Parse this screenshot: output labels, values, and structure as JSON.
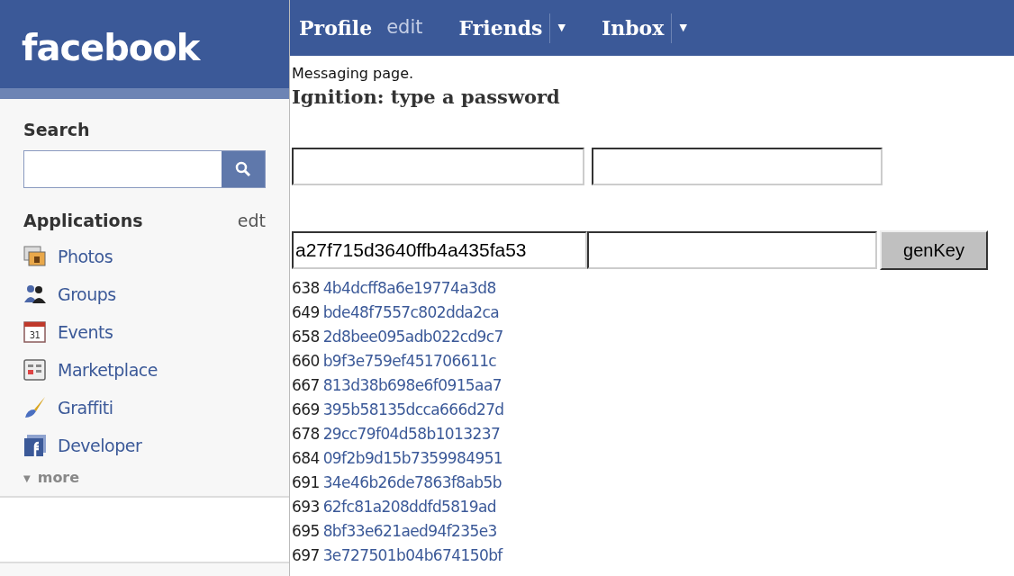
{
  "logo": "facebook",
  "nav": [
    {
      "label": "Profile",
      "kind": "link"
    },
    {
      "label": "edit",
      "kind": "sublink"
    },
    {
      "label": "Friends",
      "kind": "menu",
      "caret": "▼"
    },
    {
      "label": "Inbox",
      "kind": "menu",
      "caret": "▼"
    }
  ],
  "sidebar": {
    "search_title": "Search",
    "applications_title": "Applications",
    "applications_edit": "edt",
    "items": [
      {
        "label": "Photos",
        "kind": "photos"
      },
      {
        "label": "Groups",
        "kind": "groups"
      },
      {
        "label": "Events",
        "kind": "events",
        "icon_text": "31"
      },
      {
        "label": "Marketplace",
        "kind": "marketplace"
      },
      {
        "label": "Graffiti",
        "kind": "graffiti"
      },
      {
        "label": "Developer",
        "kind": "developer"
      }
    ],
    "more": {
      "label": "more",
      "caret": "▼"
    }
  },
  "main": {
    "intro": "Messaging page.",
    "heading": "Ignition: type a password",
    "key_field": {
      "value": "a27f715d3640ffb4a435fa53"
    },
    "button": "genKey",
    "keys": [
      {
        "num": "638",
        "hash": "4b4dcff8a6e19774a3d8"
      },
      {
        "num": "649",
        "hash": "bde48f7557c802dda2ca"
      },
      {
        "num": "658",
        "hash": "2d8bee095adb022cd9c7"
      },
      {
        "num": "660",
        "hash": "b9f3e759ef451706611c"
      },
      {
        "num": "667",
        "hash": "813d38b698e6f0915aa7"
      },
      {
        "num": "669",
        "hash": "395b58135dcca666d27d"
      },
      {
        "num": "678",
        "hash": "29cc79f04d58b1013237"
      },
      {
        "num": "684",
        "hash": "09f2b9d15b7359984951"
      },
      {
        "num": "691",
        "hash": "34e46b26de7863f8ab5b"
      },
      {
        "num": "693",
        "hash": "62fc81a208ddfd5819ad"
      },
      {
        "num": "695",
        "hash": "8bf33e621aed94f235e3"
      },
      {
        "num": "697",
        "hash": "3e727501b04b674150bf"
      }
    ]
  }
}
